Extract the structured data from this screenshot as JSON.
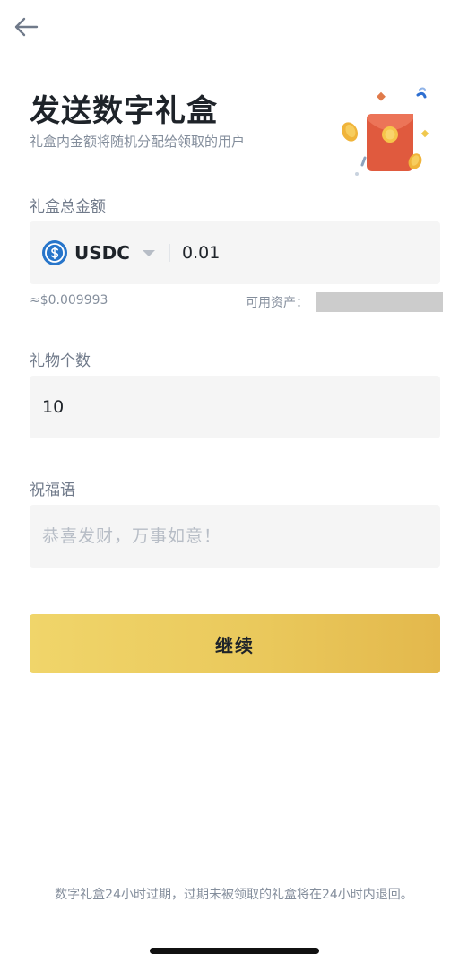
{
  "header": {
    "back_icon": "arrow-left-icon",
    "title": "发送数字礼盒",
    "subtitle": "礼盒内金额将随机分配给领取的用户",
    "illustration": "red-envelope-illustration"
  },
  "amount_section": {
    "label": "礼盒总金额",
    "coin_icon": "usdc-coin-icon",
    "coin_symbol": "USDC",
    "amount_value": "0.01",
    "usd_equivalent": "≈$0.009993",
    "available_label": "可用资产："
  },
  "count_section": {
    "label": "礼物个数",
    "value": "10"
  },
  "greeting_section": {
    "label": "祝福语",
    "placeholder": "恭喜发财，万事如意！"
  },
  "continue_button": {
    "label": "继续"
  },
  "footer": {
    "note": "数字礼盒24小时过期，过期未被领取的礼盒将在24小时内退回。"
  },
  "colors": {
    "accent_gold": "#f0d56a",
    "text_primary": "#1e2329",
    "text_secondary": "#848e9c",
    "field_bg": "#f5f5f5",
    "usdc_blue": "#2775ca"
  }
}
